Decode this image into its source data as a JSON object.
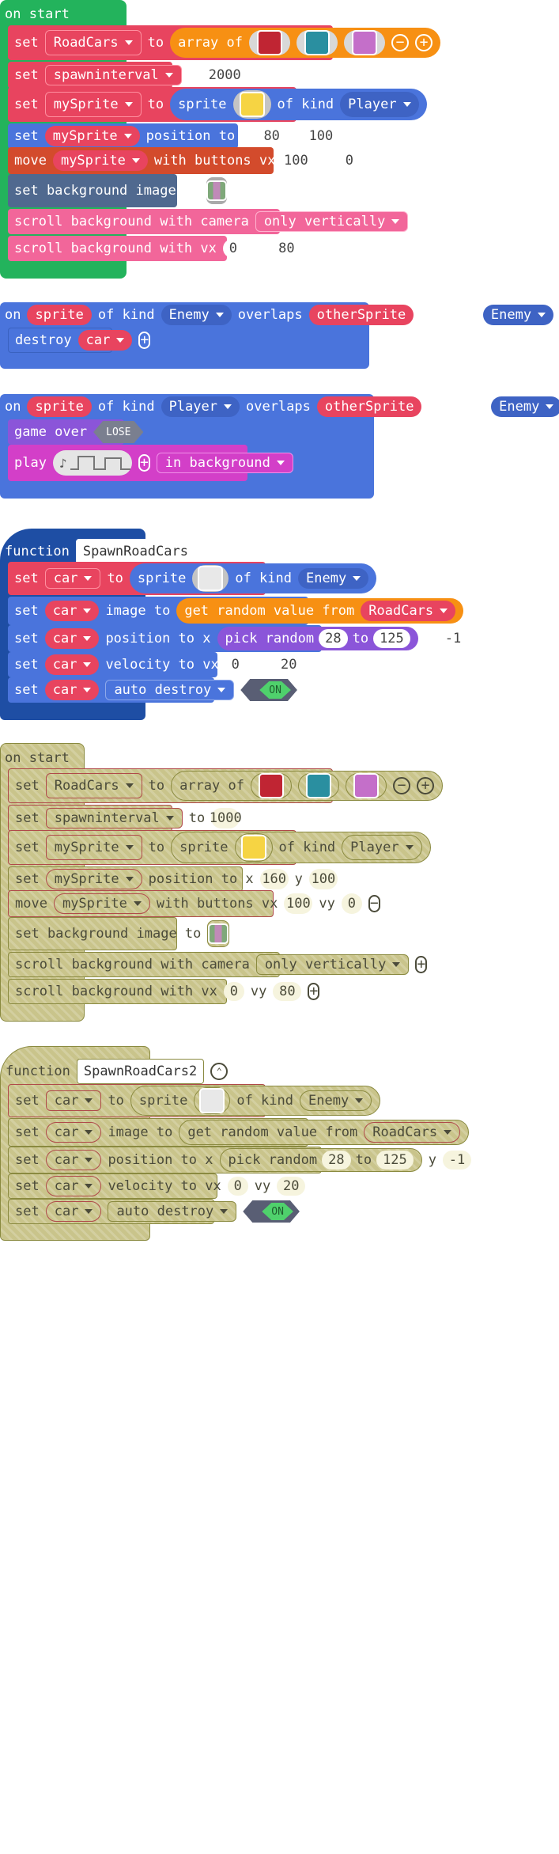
{
  "colors": {
    "green": "#23b35c",
    "red": "#e8445f",
    "blue": "#4a74dc",
    "darkblue": "#1e4ea4",
    "orange": "#f79013",
    "brown": "#d34b2c",
    "slate": "#50698f",
    "pink": "#f2669a",
    "purple": "#8b55d9",
    "magenta": "#d33fc8",
    "disabled": "#c9c48b"
  },
  "onstart1": {
    "hat": "on start",
    "set": "set",
    "to": "to",
    "array_of": "array of",
    "var_roadcars": "RoadCars",
    "var_spawninterval": "spawninterval",
    "spawn_value": "2000",
    "var_mysprite": "mySprite",
    "sprite": "sprite",
    "of_kind": "of kind",
    "kind_player": "Player",
    "position_to_x": "position to x",
    "x_val": "80",
    "y": "y",
    "y_val": "100",
    "move": "move",
    "with_buttons_vx": "with buttons vx",
    "vx_val": "100",
    "vy": "vy",
    "vy_val": "0",
    "set_bg": "set background image to",
    "scroll_camera": "scroll background with camera",
    "only_vertically": "only vertically",
    "scroll_vx": "scroll background with vx",
    "svx": "0",
    "svy": "80",
    "car_icons": [
      "car-red-icon",
      "car-teal-icon",
      "car-pink-icon"
    ]
  },
  "overlap1": {
    "on": "on",
    "sprite": "sprite",
    "of_kind": "of kind",
    "kind1": "Enemy",
    "overlaps": "overlaps",
    "other": "otherSprite",
    "kind2": "Enemy",
    "destroy": "destroy",
    "car": "car"
  },
  "overlap2": {
    "on": "on",
    "sprite": "sprite",
    "of_kind": "of kind",
    "kind1": "Player",
    "overlaps": "overlaps",
    "other": "otherSprite",
    "kind2": "Enemy",
    "game_over": "game over",
    "lose": "LOSE",
    "play": "play",
    "in_background": "in background"
  },
  "func1": {
    "function": "function",
    "name": "SpawnRoadCars",
    "set": "set",
    "car": "car",
    "to": "to",
    "sprite": "sprite",
    "of_kind": "of kind",
    "kind": "Enemy",
    "image_to": "image to",
    "get_random": "get random value from",
    "roadcars": "RoadCars",
    "position_to_x": "position to x",
    "pick_random": "pick random",
    "r1": "28",
    "r_to": "to",
    "r2": "125",
    "y": "y",
    "y_val": "-1",
    "velocity_to_vx": "velocity to vx",
    "vx": "0",
    "vy_label": "vy",
    "vy": "20",
    "auto_destroy": "auto destroy",
    "on": "ON"
  },
  "onstart2": {
    "hat": "on start",
    "spawn_value": "1000",
    "x_val": "160"
  },
  "func2": {
    "name": "SpawnRoadCars2"
  }
}
